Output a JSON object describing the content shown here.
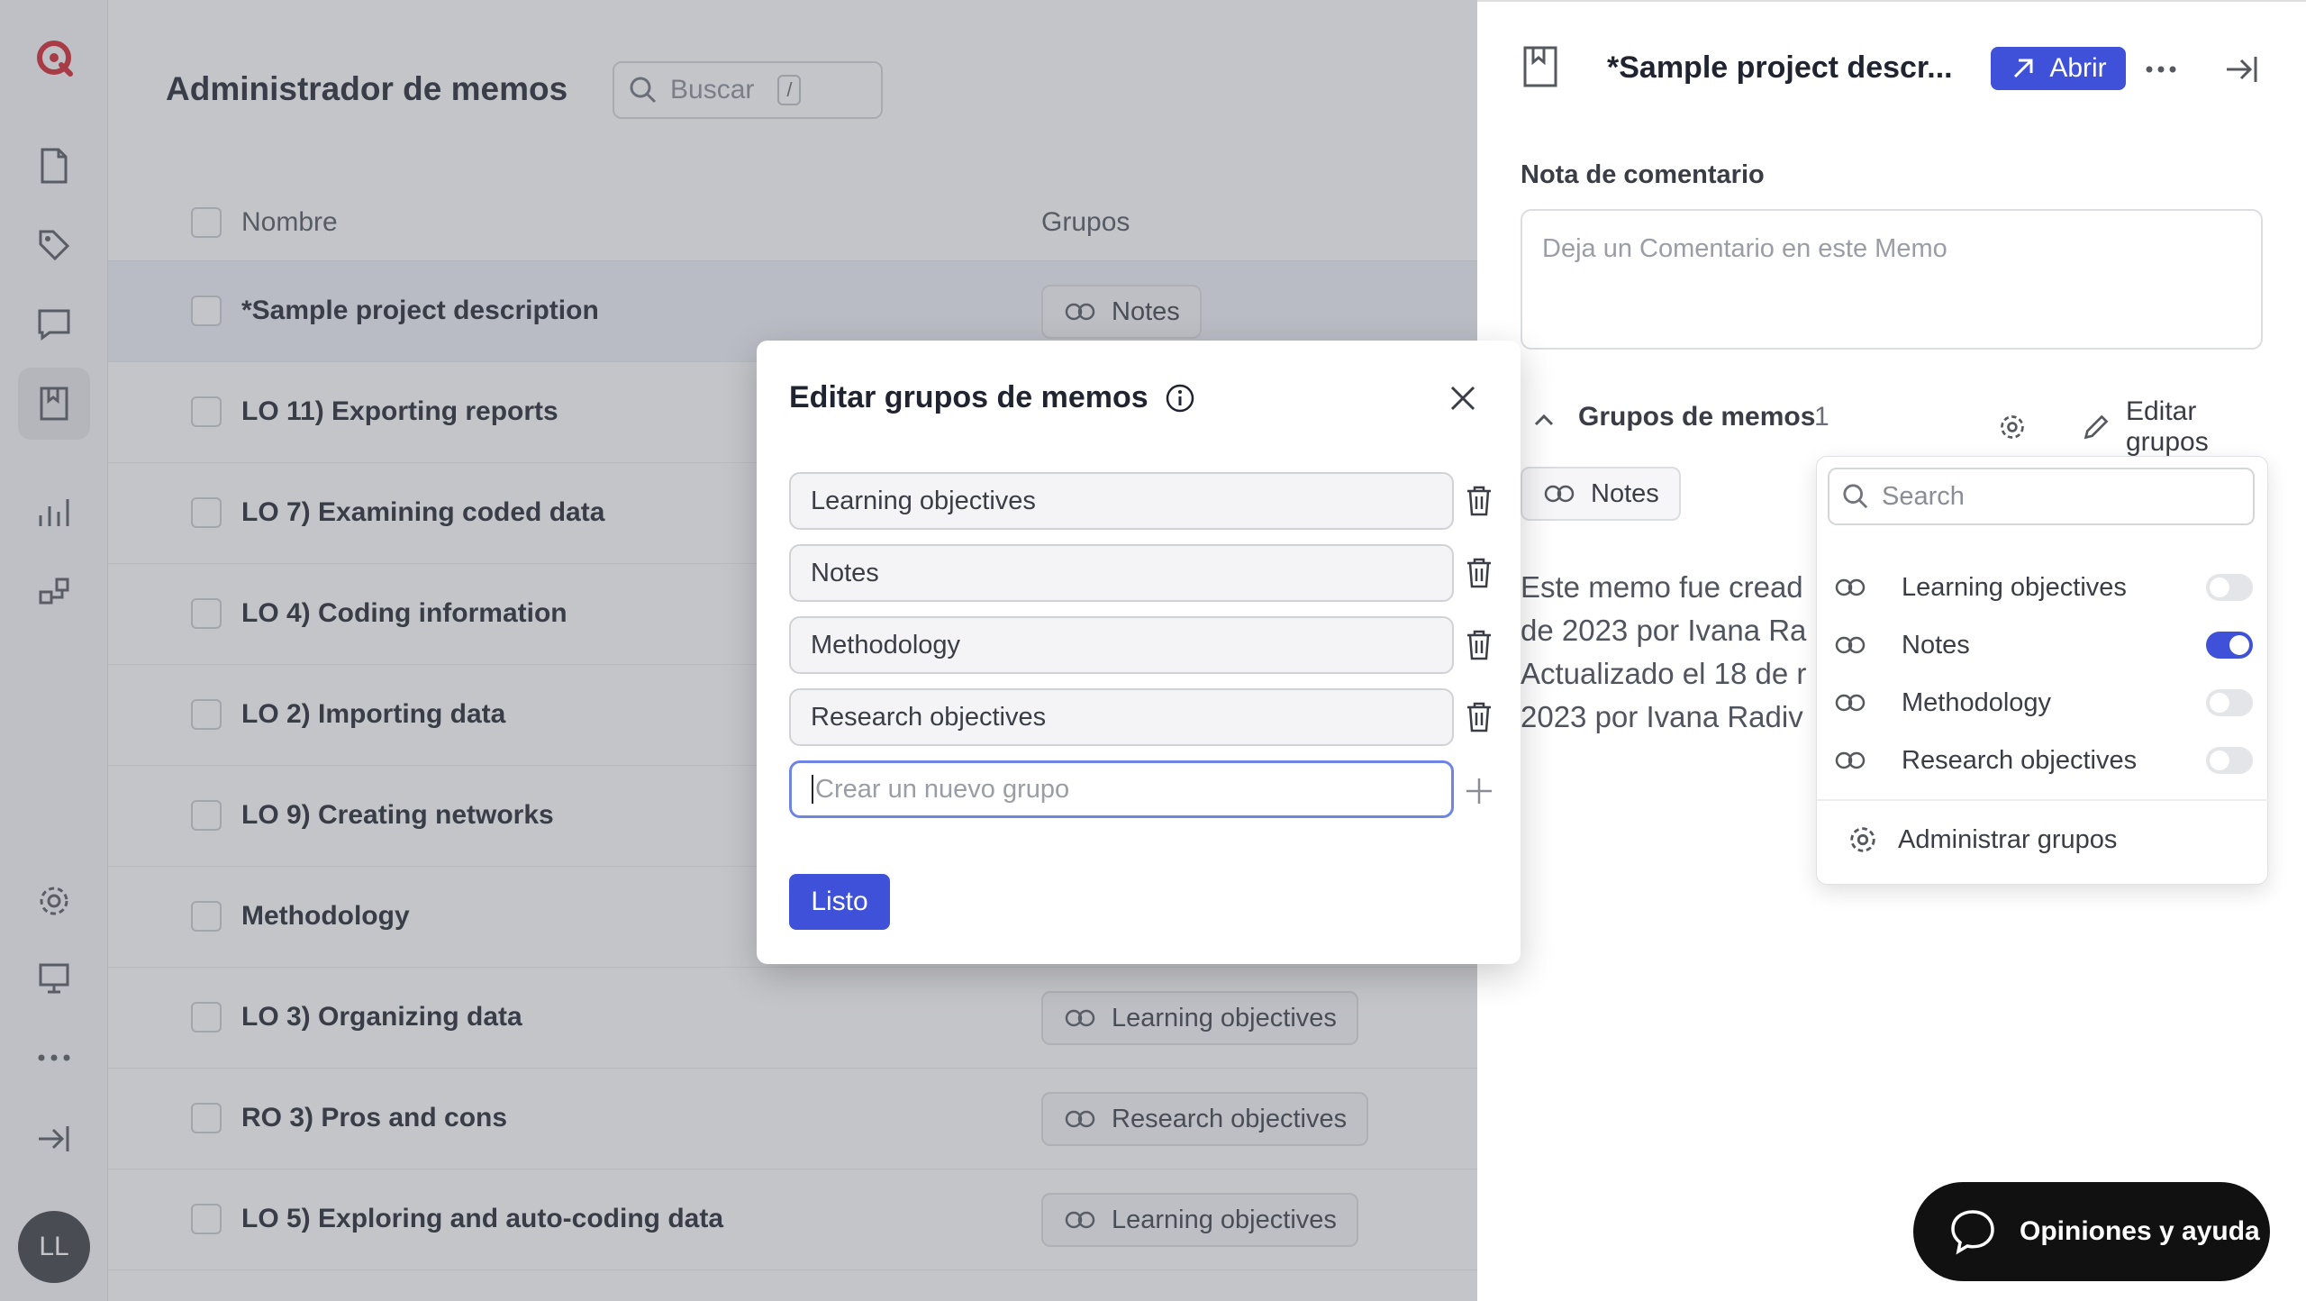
{
  "app": {
    "title": "Administrador de memos",
    "search_placeholder": "Buscar",
    "search_shortcut": "/"
  },
  "rail": {
    "avatar_initials": "LL"
  },
  "table": {
    "columns": {
      "name": "Nombre",
      "groups": "Grupos"
    },
    "rows": [
      {
        "name": "*Sample project description",
        "group": "Notes"
      },
      {
        "name": "LO 11) Exporting reports",
        "group": ""
      },
      {
        "name": "LO 7) Examining coded data",
        "group": ""
      },
      {
        "name": "LO 4) Coding information",
        "group": ""
      },
      {
        "name": "LO 2) Importing data",
        "group": ""
      },
      {
        "name": "LO 9) Creating networks",
        "group": ""
      },
      {
        "name": "Methodology",
        "group": ""
      },
      {
        "name": "LO 3) Organizing data",
        "group": "Learning objectives"
      },
      {
        "name": "RO 3) Pros and cons",
        "group": "Research objectives"
      },
      {
        "name": "LO 5) Exploring and auto-coding data",
        "group": "Learning objectives"
      }
    ]
  },
  "panel": {
    "title": "*Sample project descr...",
    "open_label": "Abrir",
    "comment_label": "Nota de comentario",
    "comment_placeholder": "Deja un Comentario en este Memo",
    "memo_groups_label": "Grupos de memos",
    "memo_groups_count": "1",
    "edit_groups_label": "Editar grupos",
    "assigned_group": "Notes",
    "memo_text_lines": [
      "Este memo fue cread",
      "de 2023 por Ivana Ra",
      "Actualizado el 18 de r",
      "2023 por Ivana Radiv"
    ]
  },
  "dropdown": {
    "search_placeholder": "Search",
    "items": [
      {
        "label": "Learning objectives",
        "on": false
      },
      {
        "label": "Notes",
        "on": true
      },
      {
        "label": "Methodology",
        "on": false
      },
      {
        "label": "Research objectives",
        "on": false
      }
    ],
    "manage_label": "Administrar grupos"
  },
  "modal": {
    "title": "Editar grupos de memos",
    "groups": [
      "Learning objectives",
      "Notes",
      "Methodology",
      "Research objectives"
    ],
    "new_group_placeholder": "Crear un nuevo grupo",
    "done_label": "Listo"
  },
  "feedback": {
    "label": "Opiniones y ayuda"
  },
  "colors": {
    "accent": "#3f51d9",
    "brand": "#d0212c"
  }
}
